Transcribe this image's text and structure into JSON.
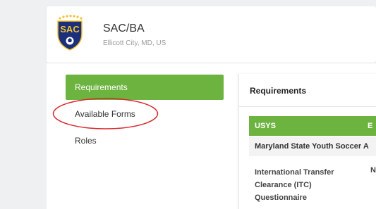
{
  "organization": {
    "name": "SAC/BA",
    "location": "Ellicott City, MD, US",
    "logo_text": "SAC",
    "logo_colors": {
      "shield": "#1c2f7a",
      "letters": "#f2c230",
      "stars": "#f2c230"
    }
  },
  "sidebar": {
    "items": [
      {
        "label": "Requirements",
        "active": true
      },
      {
        "label": "Available Forms",
        "active": false
      },
      {
        "label": "Roles",
        "active": false
      }
    ]
  },
  "panel": {
    "title": "Requirements",
    "table": {
      "columns": [
        "USYS",
        "E"
      ],
      "group": "Maryland State Youth Soccer A",
      "rows": [
        {
          "name": "International Transfer Clearance (ITC) Questionnaire",
          "col2": "N"
        }
      ]
    }
  },
  "annotation": {
    "shape": "ellipse",
    "color": "#d9262c",
    "target": "Available Forms"
  },
  "colors": {
    "accent": "#6db33f",
    "background": "#eef0f2"
  }
}
